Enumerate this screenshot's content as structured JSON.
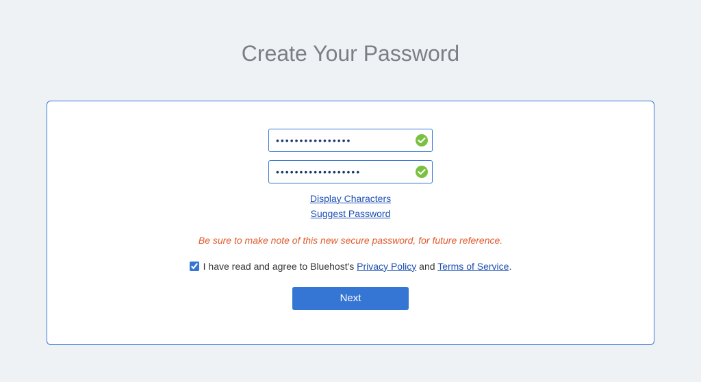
{
  "page": {
    "title": "Create Your Password"
  },
  "form": {
    "password_value": "••••••••••••••••",
    "confirm_value": "••••••••••••••••••",
    "display_chars_link": "Display Characters",
    "suggest_pw_link": "Suggest Password",
    "note": "Be sure to make note of this new secure password, for future reference.",
    "agree_prefix": "I have read and agree to Bluehost's ",
    "privacy_label": "Privacy Policy",
    "agree_mid": " and ",
    "terms_label": "Terms of Service",
    "agree_suffix": ".",
    "next_label": "Next"
  }
}
